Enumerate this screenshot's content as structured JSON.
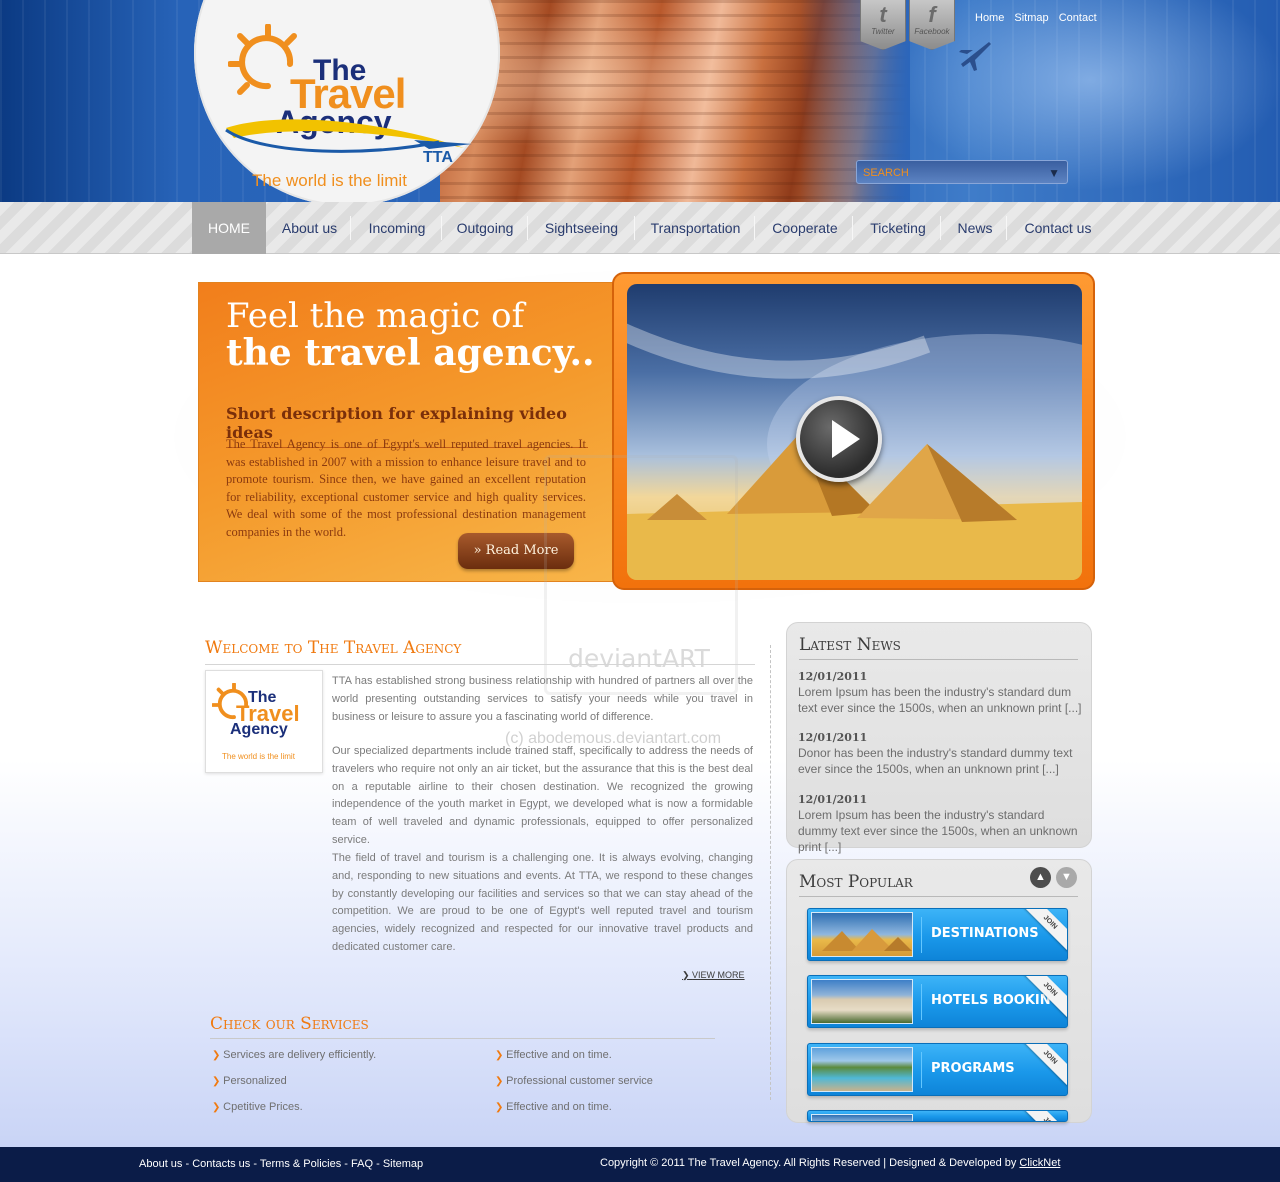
{
  "header": {
    "logo": {
      "the": "The",
      "travel": "Travel",
      "agency": "Agency",
      "tta": "TTA",
      "tagline": "The world is the limit"
    },
    "social": [
      {
        "label": "Twitter",
        "glyph": "t"
      },
      {
        "label": "Facebook",
        "glyph": "f"
      }
    ],
    "top_links": [
      "Home",
      "Sitmap",
      "Contact"
    ],
    "search": {
      "placeholder": "SEARCH"
    }
  },
  "nav": {
    "items": [
      "HOME",
      "About us",
      "Incoming",
      "Outgoing",
      "Sightseeing",
      "Transportation",
      "Cooperate",
      "Ticketing",
      "News",
      "Contact us"
    ],
    "active": "HOME"
  },
  "hero": {
    "title_line1": "Feel the magic of",
    "title_line2": "the travel agency..",
    "subtitle": "Short description for explaining video ideas",
    "text": "The Travel Agency is one of Egypt's well reputed travel agencies. It was established in 2007 with a mission to enhance leisure travel and to promote tourism. Since then, we have gained an excellent reputation for reliability, exceptional customer service and high quality services. We deal with some of the most professional destination management companies in the world.",
    "read_more": "» Read More"
  },
  "welcome": {
    "title": "Welcome to The Travel Agency",
    "paragraphs": [
      "TTA has established strong business relationship with hundred of partners all over the world presenting outstanding services to satisfy your needs while you travel in business or leisure to assure you a fascinating world of difference.",
      "Our specialized departments include trained staff, specifically to address the needs of travelers who require not only an air ticket, but the assurance that this is the best deal on a reputable airline to their chosen destination. We recognized the growing independence of the youth market in Egypt, we developed what is now a formidable team of well traveled and dynamic professionals, equipped to offer personalized service.",
      "The field of travel and tourism is a challenging one. It is always evolving, changing and, responding to new situations and events. At TTA, we respond to these changes by constantly developing our facilities and services so that we can stay ahead of the competition. We are proud to be one of Egypt's well reputed travel and tourism agencies, widely recognized and respected for our innovative travel products and dedicated customer care."
    ],
    "view_more": "VIEW MORE"
  },
  "services": {
    "title": "Check our Services",
    "left": [
      "Services are delivery efficiently.",
      "Personalized",
      "Cpetitive Prices."
    ],
    "right": [
      "Effective and on time.",
      "Professional customer service",
      "Effective and on time."
    ]
  },
  "latest_news": {
    "title": "Latest News",
    "items": [
      {
        "date": "12/01/2011",
        "text": "Lorem Ipsum has been the industry's standard dum text ever since the 1500s, when an unknown print [...]"
      },
      {
        "date": "12/01/2011",
        "text": "Donor has been the industry's standard dummy text ever since the 1500s, when an unknown print       [...]"
      },
      {
        "date": "12/01/2011",
        "text": "Lorem Ipsum has been the industry's standard dummy text ever since the 1500s, when an unknown print [...]"
      }
    ]
  },
  "most_popular": {
    "title": "Most Popular",
    "up_icon": "▲",
    "down_icon": "▼",
    "items": [
      {
        "label": "DESTINATIONS",
        "badge": "JOIN"
      },
      {
        "label": "HOTELS BOOKING",
        "badge": "JOIN"
      },
      {
        "label": "PROGRAMS",
        "badge": "JOIN"
      },
      {
        "label": "",
        "badge": "JOIN"
      }
    ]
  },
  "watermark": {
    "line1": "deviantART",
    "line2": "(c) abodemous.deviantart.com"
  },
  "footer": {
    "links": [
      "About us",
      "Contacts us",
      "Terms & Policies",
      "FAQ",
      "Sitemap"
    ],
    "separator": "-",
    "copyright": "Copyright © 2011 The Travel Agency. All Rights Reserved | Designed & Developed by ",
    "developer": "ClickNet"
  },
  "colors": {
    "accent_orange": "#f07a10",
    "header_blue": "#2b66bb",
    "footer_navy": "#0b1c48",
    "promo_blue": "#1a98ea"
  }
}
